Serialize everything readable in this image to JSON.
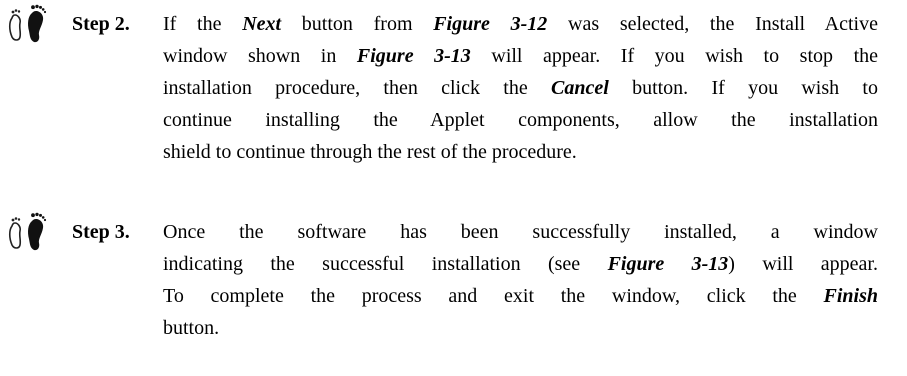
{
  "steps": [
    {
      "label": "Step 2.",
      "lines": [
        [
          "If the ",
          {
            "i": "Next"
          },
          " button from ",
          {
            "b": "Figure 3-12"
          },
          " was selected, the Install Active"
        ],
        [
          "window shown in ",
          {
            "b": "Figure 3-13"
          },
          " will appear. If you wish to stop the"
        ],
        [
          "installation procedure, then click the ",
          {
            "b": "Cancel"
          },
          " button. If you wish to"
        ],
        [
          "continue installing the Applet components, allow the installation"
        ],
        [
          "shield to continue through the rest of the procedure."
        ]
      ]
    },
    {
      "label": "Step 3.",
      "lines": [
        [
          "Once the software has been successfully installed, a window"
        ],
        [
          "indicating the successful installation (see ",
          {
            "b": "Figure 3-13"
          },
          ") will appear."
        ],
        [
          "To complete the process and exit the window, click the ",
          {
            "b": "Finish"
          }
        ],
        [
          "button."
        ]
      ]
    }
  ]
}
